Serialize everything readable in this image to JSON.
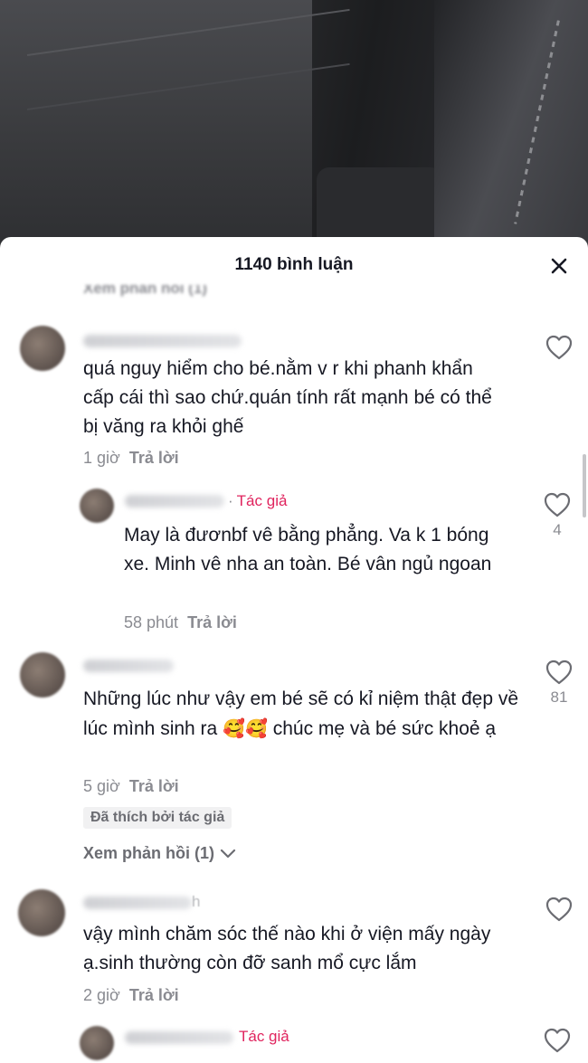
{
  "sheet": {
    "title": "1140 bình luận",
    "ghost_reply": "Xem phản hồi (1)"
  },
  "comments": [
    {
      "text": "quá nguy hiểm cho bé.nằm v r khi phanh khẩn cấp cái thì sao chứ.quán tính rất mạnh bé có thể bị văng ra khỏi ghế",
      "time": "1 giờ",
      "reply": "Trả lời",
      "likes": ""
    },
    {
      "author_tag": "Tác giả",
      "text": "May là đươnbf vê bằng phẳng. Va k 1 bóng xe. Minh vê nha an toàn. Bé vân ngủ ngoan",
      "time": "58 phút",
      "reply": "Trả lời",
      "likes": "4"
    },
    {
      "text_before_emoji": "Những lúc như vậy em bé sẽ có kỉ niệm thật đẹp về lúc mình sinh ra ",
      "emoji": "🥰🥰",
      "text_after_emoji": " chúc mẹ và bé sức khoẻ ạ",
      "time": "5 giờ",
      "reply": "Trả lời",
      "likes": "81",
      "badge": "Đã thích bởi tác giả",
      "view_replies": "Xem phản hồi (1)"
    },
    {
      "username_fragment": "h",
      "text": "vậy mình chăm sóc thế nào khi ở viện mấy ngày ạ.sinh thường còn đỡ sanh mổ cực lắm",
      "time": "2 giờ",
      "reply": "Trả lời",
      "likes": ""
    },
    {
      "author_tag": "Tác giả"
    }
  ],
  "icons": {
    "close": "close-icon",
    "like": "heart-outline-icon",
    "chevron": "chevron-down-icon"
  },
  "colors": {
    "author_tag": "#e0245e",
    "muted": "#8a8b91",
    "text": "#161823"
  }
}
